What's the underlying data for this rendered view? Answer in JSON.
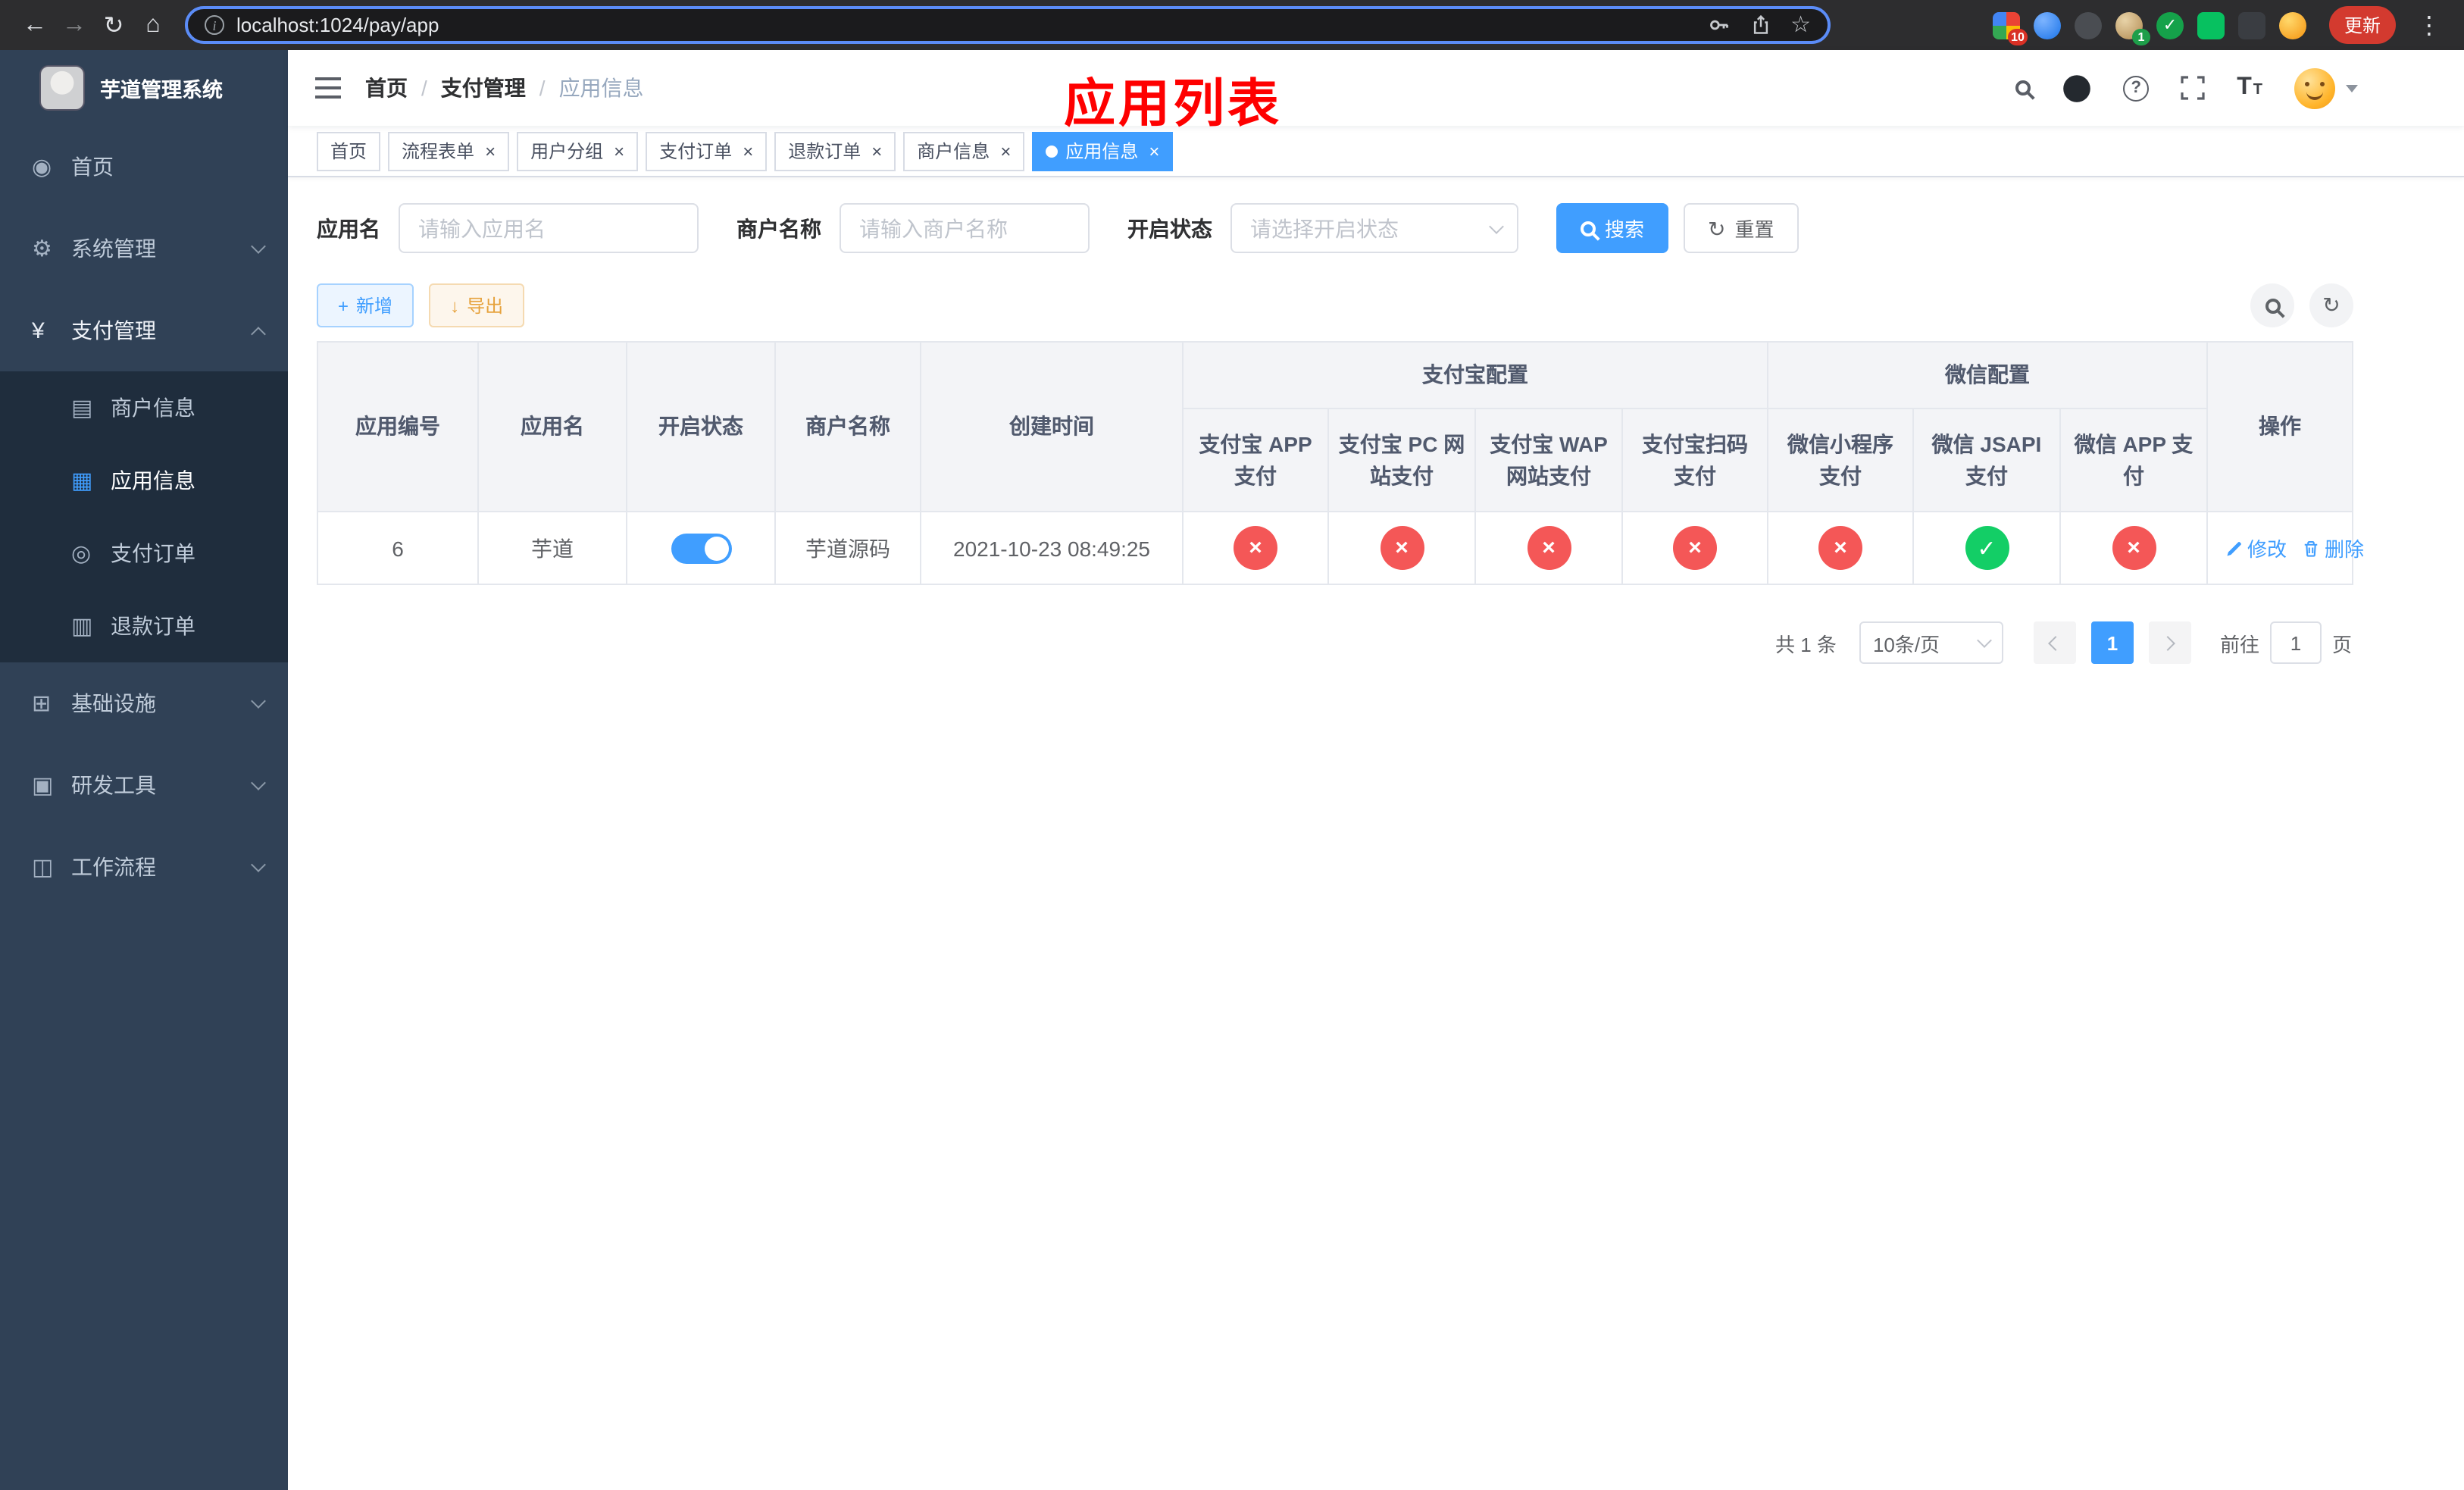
{
  "browser": {
    "url": "localhost:1024/pay/app",
    "update_button": "更新",
    "ext_badge_10": "10",
    "ext_badge_1": "1"
  },
  "sidebar": {
    "title": "芋道管理系统",
    "menu": [
      {
        "label": "首页"
      },
      {
        "label": "系统管理"
      },
      {
        "label": "支付管理"
      },
      {
        "label": "商户信息"
      },
      {
        "label": "应用信息"
      },
      {
        "label": "支付订单"
      },
      {
        "label": "退款订单"
      },
      {
        "label": "基础设施"
      },
      {
        "label": "研发工具"
      },
      {
        "label": "工作流程"
      }
    ]
  },
  "header": {
    "breadcrumb": [
      "首页",
      "支付管理",
      "应用信息"
    ],
    "overlay_title": "应用列表"
  },
  "tabs": [
    {
      "label": "首页"
    },
    {
      "label": "流程表单"
    },
    {
      "label": "用户分组"
    },
    {
      "label": "支付订单"
    },
    {
      "label": "退款订单"
    },
    {
      "label": "商户信息"
    },
    {
      "label": "应用信息"
    }
  ],
  "filters": {
    "app_name_label": "应用名",
    "app_name_placeholder": "请输入应用名",
    "merchant_label": "商户名称",
    "merchant_placeholder": "请输入商户名称",
    "status_label": "开启状态",
    "status_placeholder": "请选择开启状态",
    "search_button": "搜索",
    "reset_button": "重置"
  },
  "toolbar": {
    "add_button": "新增",
    "export_button": "导出"
  },
  "table": {
    "headers": {
      "app_id": "应用编号",
      "app_name": "应用名",
      "status": "开启状态",
      "merchant": "商户名称",
      "created": "创建时间",
      "alipay_group": "支付宝配置",
      "wechat_group": "微信配置",
      "actions": "操作",
      "alipay_app": "支付宝 APP 支付",
      "alipay_pc": "支付宝 PC 网站支付",
      "alipay_wap": "支付宝 WAP 网站支付",
      "alipay_qr": "支付宝扫码支付",
      "wx_mini": "微信小程序支付",
      "wx_jsapi": "微信 JSAPI 支付",
      "wx_app": "微信 APP 支付"
    },
    "rows": [
      {
        "app_id": "6",
        "app_name": "芋道",
        "status_on": true,
        "merchant": "芋道源码",
        "created": "2021-10-23 08:49:25",
        "configs": [
          false,
          false,
          false,
          false,
          false,
          true,
          false
        ],
        "edit_label": "修改",
        "delete_label": "删除"
      }
    ]
  },
  "pagination": {
    "total": "共 1 条",
    "page_size": "10条/页",
    "current_page": "1",
    "goto_prefix": "前往",
    "goto_value": "1",
    "goto_suffix": "页"
  },
  "icons": {
    "back": "←",
    "forward": "→",
    "reload": "↻",
    "home": "⌂",
    "info": "i",
    "star": "☆",
    "more": "⋮",
    "check_ext": "✓",
    "question": "?",
    "slash": "/",
    "dashboard": "◉",
    "gear": "⚙",
    "yen": "¥",
    "merchant": "▤",
    "app": "▦",
    "order": "◎",
    "refund": "▥",
    "infra": "⊞",
    "tools": "▣",
    "workflow": "◫",
    "plus": "+",
    "download": "↓",
    "refresh": "↻",
    "close": "×",
    "check": "✓",
    "font_big": "T",
    "font_small": "T"
  },
  "colors": {
    "primary": "#409eff",
    "danger": "#f45757",
    "success": "#13ce66",
    "annotation": "#fe0000"
  }
}
